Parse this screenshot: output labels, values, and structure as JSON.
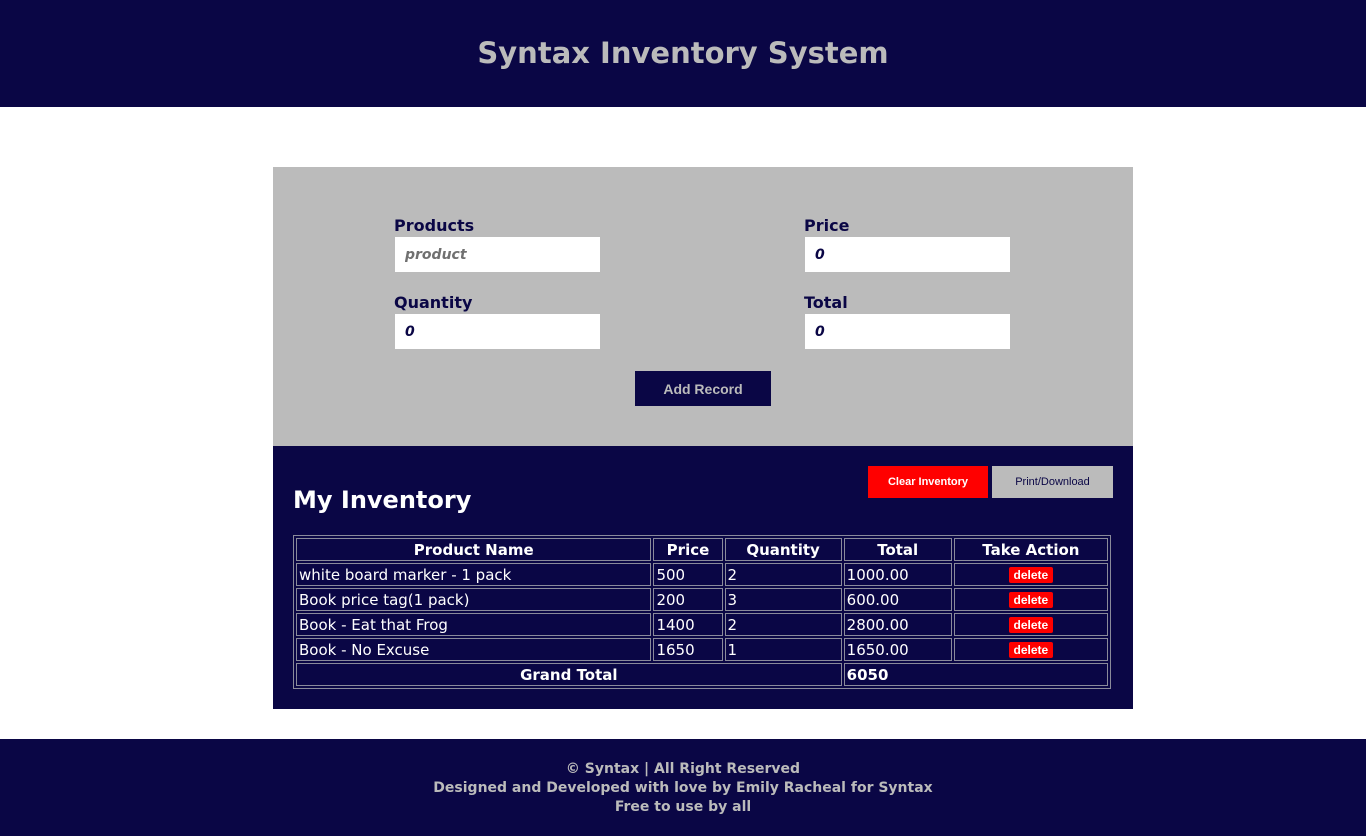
{
  "header": {
    "title": "Syntax Inventory System"
  },
  "form": {
    "products": {
      "label": "Products",
      "placeholder": "product",
      "value": ""
    },
    "price": {
      "label": "Price",
      "value": "0"
    },
    "quantity": {
      "label": "Quantity",
      "value": "0"
    },
    "total": {
      "label": "Total",
      "value": "0"
    },
    "add_button": "Add Record"
  },
  "inventory": {
    "title": "My Inventory",
    "clear_button": "Clear Inventory",
    "print_button": "Print/Download",
    "columns": [
      "Product Name",
      "Price",
      "Quantity",
      "Total",
      "Take Action"
    ],
    "rows": [
      {
        "name": "white board marker - 1 pack",
        "price": "500",
        "quantity": "2",
        "total": "1000.00",
        "action": "delete"
      },
      {
        "name": "Book price tag(1 pack)",
        "price": "200",
        "quantity": "3",
        "total": "600.00",
        "action": "delete"
      },
      {
        "name": "Book - Eat that Frog",
        "price": "1400",
        "quantity": "2",
        "total": "2800.00",
        "action": "delete"
      },
      {
        "name": "Book - No Excuse",
        "price": "1650",
        "quantity": "1",
        "total": "1650.00",
        "action": "delete"
      }
    ],
    "grand_total_label": "Grand Total",
    "grand_total_value": "6050"
  },
  "footer": {
    "line1": "© Syntax | All Right Reserved",
    "line2": "Designed and Developed with love by Emily Racheal for Syntax",
    "line3": "Free to use by all"
  },
  "colors": {
    "navy": "#0a0645",
    "gray": "#bbbbbb",
    "red": "#ff0000"
  }
}
